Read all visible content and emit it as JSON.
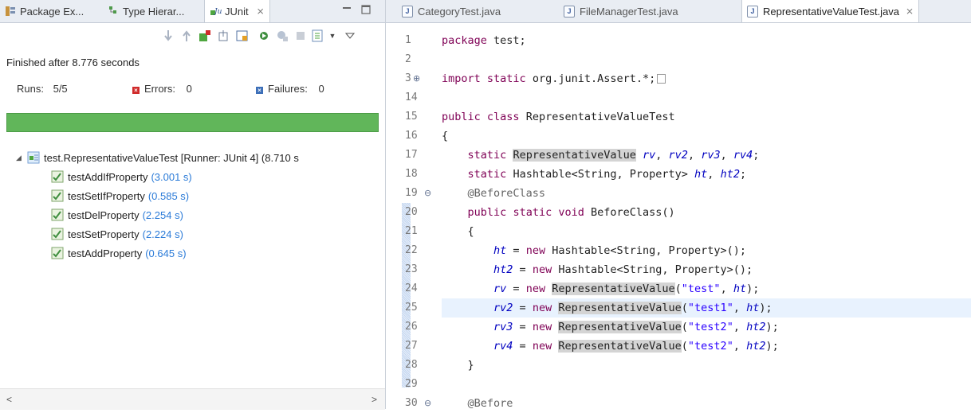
{
  "left_tabs": {
    "package_explorer": "Package Ex...",
    "type_hierarchy": "Type Hierar...",
    "junit": "JUnit",
    "close_glyph": "⨯"
  },
  "status": "Finished after 8.776 seconds",
  "counters": {
    "runs_label": "Runs:",
    "runs_value": "5/5",
    "errors_label": "Errors:",
    "errors_value": "0",
    "failures_label": "Failures:",
    "failures_value": "0"
  },
  "progress": {
    "fraction": 1.0,
    "color": "#61b65a"
  },
  "tree": {
    "root": "test.RepresentativeValueTest [Runner: JUnit 4] (8.710 s",
    "tests": [
      {
        "name": "testAddIfProperty",
        "time": "(3.001 s)"
      },
      {
        "name": "testSetIfProperty",
        "time": "(0.585 s)"
      },
      {
        "name": "testDelProperty",
        "time": "(2.254 s)"
      },
      {
        "name": "testSetProperty",
        "time": "(2.224 s)"
      },
      {
        "name": "testAddProperty",
        "time": "(0.645 s)"
      }
    ]
  },
  "editor_tabs": [
    {
      "label": "CategoryTest.java",
      "active": false
    },
    {
      "label": "FileManagerTest.java",
      "active": false
    },
    {
      "label": "RepresentativeValueTest.java",
      "active": true
    }
  ],
  "code_lines": [
    {
      "num": "1"
    },
    {
      "num": "2"
    },
    {
      "num": "3"
    },
    {
      "num": "14"
    },
    {
      "num": "15"
    },
    {
      "num": "16"
    },
    {
      "num": "17"
    },
    {
      "num": "18"
    },
    {
      "num": "19"
    },
    {
      "num": "20"
    },
    {
      "num": "21"
    },
    {
      "num": "22"
    },
    {
      "num": "23"
    },
    {
      "num": "24"
    },
    {
      "num": "25"
    },
    {
      "num": "26"
    },
    {
      "num": "27"
    },
    {
      "num": "28"
    },
    {
      "num": "29"
    },
    {
      "num": "30"
    }
  ],
  "code": {
    "l1_kw": "package",
    "l1_rest": " test;",
    "l3_kw1": "import",
    "l3_kw2": "static",
    "l3_rest": " org.junit.Assert.*;",
    "l15_kw1": "public",
    "l15_kw2": "class",
    "l15_rest": " RepresentativeValueTest",
    "l16": "{",
    "l17_kw": "static",
    "l17_type": "RepresentativeValue",
    "l17_f1": "rv",
    "l17_f2": "rv2",
    "l17_f3": "rv3",
    "l17_f4": "rv4",
    "l18_kw": "static",
    "l18_type": "Hashtable<String, Property>",
    "l18_f1": "ht",
    "l18_f2": "ht2",
    "l19": "@BeforeClass",
    "l20_kw1": "public",
    "l20_kw2": "static",
    "l20_kw3": "void",
    "l20_rest": " BeforeClass()",
    "l21": "{",
    "l22_f": "ht",
    "l22_kw": "new",
    "l22_rest": " Hashtable<String, Property>();",
    "l23_f": "ht2",
    "l23_kw": "new",
    "l23_rest": " Hashtable<String, Property>();",
    "l24_f": "rv",
    "l24_s": "\"test\"",
    "l24_f2": "ht",
    "l25_f": "rv2",
    "l25_s": "\"test1\"",
    "l25_f2": "ht",
    "l26_f": "rv3",
    "l26_s": "\"test2\"",
    "l26_f2": "ht2",
    "l27_f": "rv4",
    "l27_s": "\"test2\"",
    "l27_f2": "ht2",
    "type_rv": "RepresentativeValue",
    "new_kw": "new",
    "l28": "}",
    "l30": "@Before"
  }
}
